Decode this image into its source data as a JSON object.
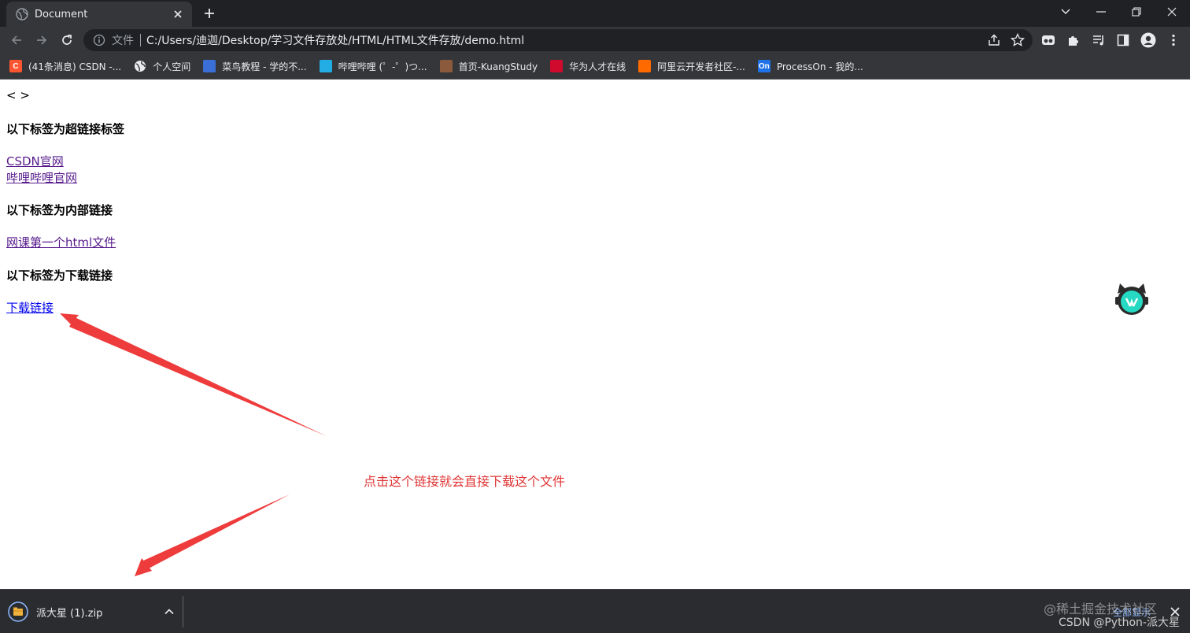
{
  "browser": {
    "tab_title": "Document",
    "omnibox": {
      "security_label": "文件",
      "url": "C:/Users/迪迦/Desktop/学习文件存放处/HTML/HTML文件存放/demo.html"
    }
  },
  "bookmarks": [
    {
      "label": "(41条消息) CSDN -...",
      "icon": "csdn-icon",
      "icon_text": "C",
      "color": "#fc5531"
    },
    {
      "label": "个人空间",
      "icon": "globe-icon",
      "icon_text": "",
      "color": "#e8eaed"
    },
    {
      "label": "菜鸟教程 - 学的不...",
      "icon": "runoob-icon",
      "icon_text": "",
      "color": "#3b6fd8"
    },
    {
      "label": "哔哩哔哩 (゜-゜)つ...",
      "icon": "bilibili-icon",
      "icon_text": "",
      "color": "#23ade5"
    },
    {
      "label": "首页-KuangStudy",
      "icon": "kuangstudy-icon",
      "icon_text": "",
      "color": "#8b5a3c"
    },
    {
      "label": "华为人才在线",
      "icon": "huawei-icon",
      "icon_text": "",
      "color": "#cf0a2c"
    },
    {
      "label": "阿里云开发者社区-...",
      "icon": "aliyun-icon",
      "icon_text": "",
      "color": "#ff6a00"
    },
    {
      "label": "ProcessOn - 我的...",
      "icon": "processon-icon",
      "icon_text": "On",
      "color": "#1f72e8"
    }
  ],
  "page": {
    "header_text": "< >",
    "section_hyperlinks": "以下标签为超链接标签",
    "link_csdn": "CSDN官网",
    "link_bilibili": "哔哩哔哩官网",
    "section_internal": "以下标签为内部链接",
    "link_first_html": "网课第一个html文件",
    "section_download": "以下标签为下载链接",
    "link_download": "下载链接",
    "annotation": "点击这个链接就会直接下载这个文件",
    "annotation_color": "#e03434"
  },
  "download_shelf": {
    "file_name": "派大星 (1).zip",
    "show_all": "全部显示"
  },
  "watermark": {
    "line1": "@稀土掘金技术社区",
    "line2": "CSDN @Python-派大星"
  }
}
